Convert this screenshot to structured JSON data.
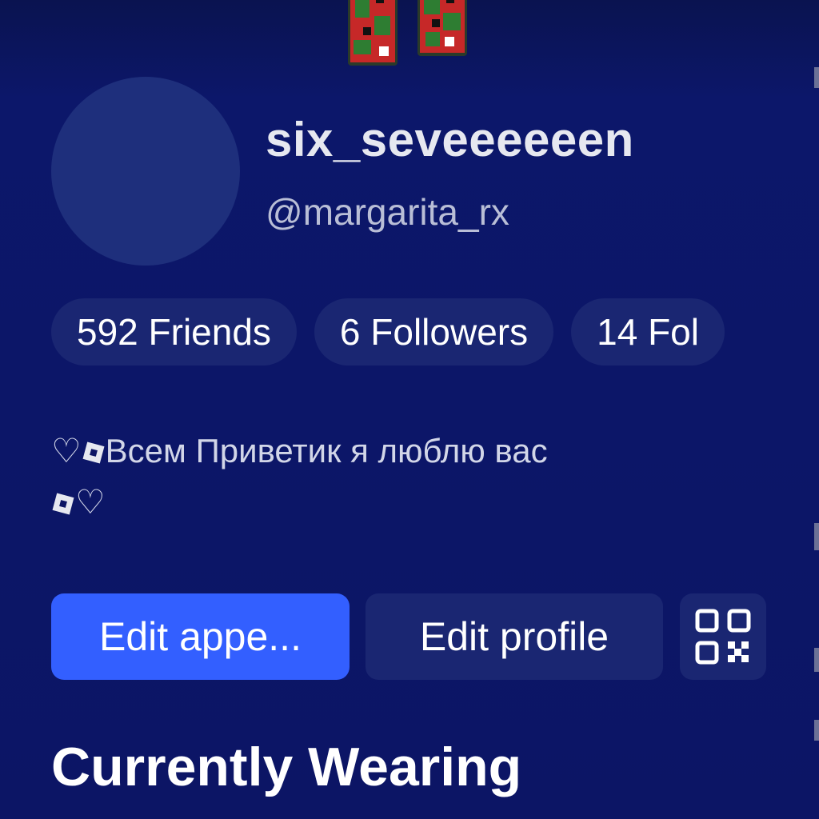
{
  "profile": {
    "display_name": "six_seveeeeeen",
    "username": "@margarita_rx"
  },
  "stats": [
    {
      "label": "592 Friends"
    },
    {
      "label": "6 Followers"
    },
    {
      "label": "14 Fol"
    }
  ],
  "bio": {
    "line1_heart": "♡",
    "line1_text": "Всем Приветик я люблю вас",
    "line2_heart": "♡"
  },
  "actions": {
    "edit_appearance": "Edit appe...",
    "edit_profile": "Edit profile",
    "qr_icon": "qr-code-icon"
  },
  "sections": {
    "currently_wearing": "Currently Wearing"
  },
  "colors": {
    "background": "#0c1565",
    "pill": "#1a2672",
    "primary_button": "#335fff",
    "text": "#ffffff"
  }
}
